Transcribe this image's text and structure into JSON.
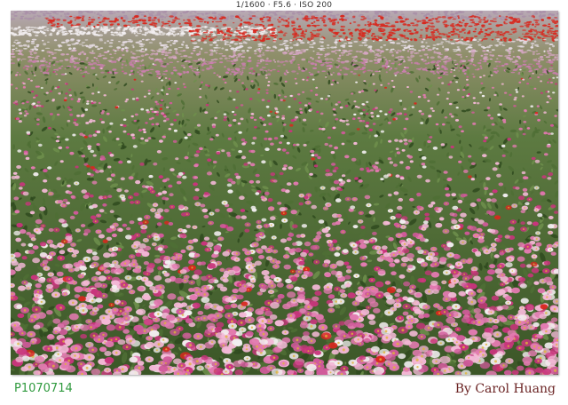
{
  "exif_line": "1/1600 · F5.6 · ISO 200",
  "file_id": "P1070714",
  "credit": "By Carol Huang",
  "colors": {
    "foliage_dark": "#2f4a1f",
    "foliage": "#4f6e35",
    "pink": "#e27ab0",
    "light_pink": "#f3b8d6",
    "magenta": "#c8357c",
    "red": "#d8281e",
    "white": "#f2eef0",
    "file_id_green": "#2f9a3e",
    "credit_maroon": "#6b2424"
  }
}
